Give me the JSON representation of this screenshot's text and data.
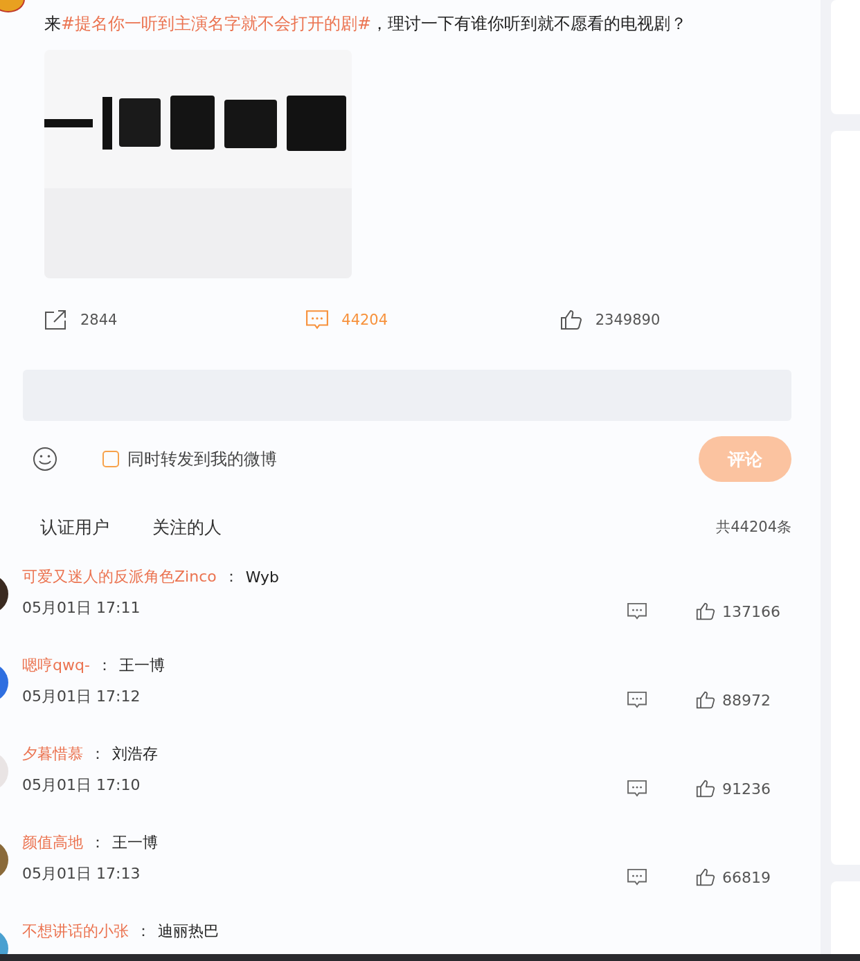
{
  "post": {
    "text_parts": [
      {
        "kind": "plain",
        "text": "来"
      },
      {
        "kind": "topic",
        "text": "#提名你一听到主演名字就不会打开的剧#"
      },
      {
        "kind": "plain",
        "text": "，理讨一下有谁你听到就不愿看的电视剧？"
      }
    ],
    "actions": [
      {
        "kind": "share",
        "count": "2844",
        "selected": false
      },
      {
        "kind": "comment",
        "count": "44204",
        "selected": true
      },
      {
        "kind": "like",
        "count": "2349890",
        "selected": false
      }
    ]
  },
  "composer": {
    "repost": {
      "label": "同时转发到我的微博",
      "checked": false
    },
    "submit": {
      "label": "评论",
      "disabled": true
    }
  },
  "filters": {
    "tabs": [
      {
        "label": "认证用户",
        "selected": false
      },
      {
        "label": "关注的人",
        "selected": false
      }
    ],
    "total": "共44204条"
  },
  "comments": [
    {
      "author": "可爱又迷人的反派角色Zinco",
      "separator": "：",
      "text": "Wyb",
      "time": "05月01日 17:11",
      "likes": "137166"
    },
    {
      "author": "嗯哼qwq-",
      "separator": "：",
      "text": "王一博",
      "time": "05月01日 17:12",
      "likes": "88972"
    },
    {
      "author": "夕暮惜慕",
      "separator": "：",
      "text": "刘浩存",
      "time": "05月01日 17:10",
      "likes": "91236"
    },
    {
      "author": "颜值高地",
      "separator": "：",
      "text": "王一博",
      "time": "05月01日 17:13",
      "likes": "66819"
    },
    {
      "author": "不想讲话的小张",
      "separator": "：",
      "text": "迪丽热巴"
    }
  ]
}
